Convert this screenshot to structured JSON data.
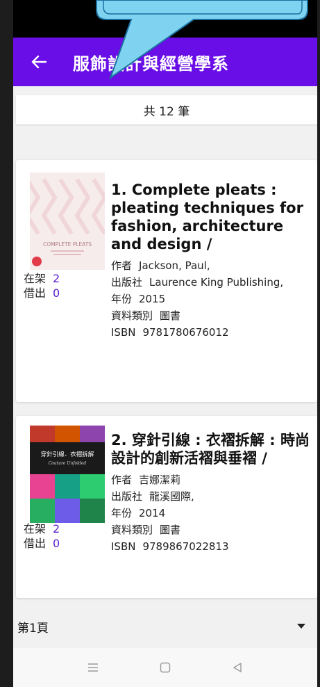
{
  "app_bar": {
    "title": "服飾設計與經營學系",
    "back_icon": "arrow-left-icon"
  },
  "colors": {
    "app_bar": "#6a0ee8",
    "count_accent": "#5a1fd1"
  },
  "result_count": "共 12 筆",
  "labels": {
    "on_shelf": "在架",
    "borrowed": "借出",
    "author": "作者",
    "publisher": "出版社",
    "year": "年份",
    "type": "資料類別",
    "isbn": "ISBN"
  },
  "books": [
    {
      "title": "1. Complete pleats : pleating techniques for fashion, architecture and design /",
      "author": "Jackson, Paul,",
      "publisher": "Laurence King Publishing,",
      "year": "2015",
      "type": "圖書",
      "isbn": "9781780676012",
      "on_shelf": "2",
      "borrowed": "0",
      "cover_title": "COMPLETE PLEATS"
    },
    {
      "title": "2. 穿針引線 : 衣褶拆解 : 時尚設計的創新活褶與垂褶 /",
      "author": "吉娜潔莉",
      "publisher": "龍溪國際,",
      "year": "2014",
      "type": "圖書",
      "isbn": "9789867022813",
      "on_shelf": "2",
      "borrowed": "0",
      "cover_title": "穿針引線．衣褶拆解",
      "cover_subtitle": "Couture Unfolded"
    }
  ],
  "pager": {
    "current": "第1頁",
    "caret_icon": "caret-down-icon"
  },
  "nav": {
    "menu_icon": "menu-icon",
    "home_icon": "home-square-icon",
    "back_icon": "back-triangle-icon"
  }
}
